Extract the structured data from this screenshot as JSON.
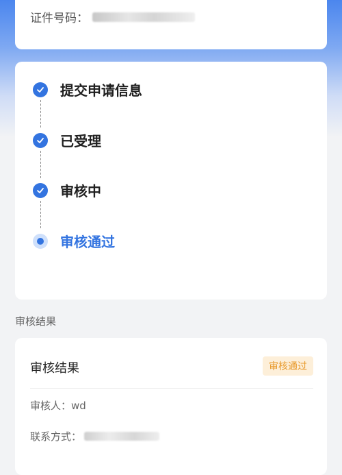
{
  "id_card": {
    "label": "证件号码："
  },
  "progress": {
    "steps": [
      {
        "label": "提交申请信息",
        "status": "done"
      },
      {
        "label": "已受理",
        "status": "done"
      },
      {
        "label": "审核中",
        "status": "done"
      },
      {
        "label": "审核通过",
        "status": "current"
      }
    ]
  },
  "section": {
    "title": "审核结果"
  },
  "result": {
    "title": "审核结果",
    "badge": "审核通过",
    "reviewer_label": "审核人：",
    "reviewer": "wd",
    "contact_label": "联系方式："
  },
  "colors": {
    "accent": "#3374e0",
    "badge_bg": "#fdefd9",
    "badge_text": "#e89a2c"
  }
}
